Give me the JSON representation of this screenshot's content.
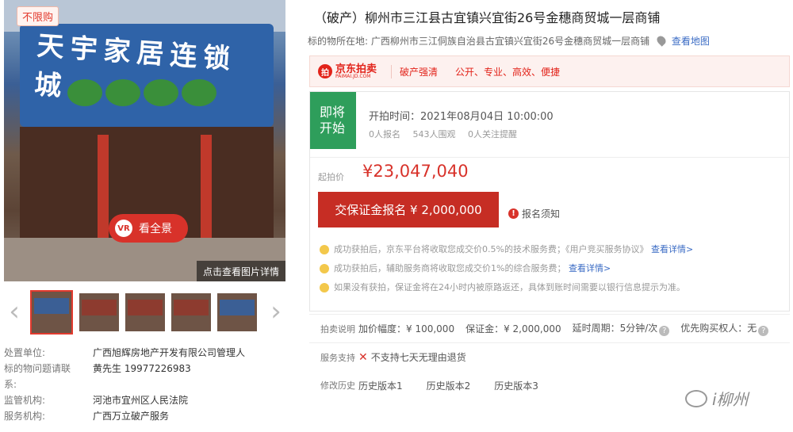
{
  "gallery": {
    "badge": "不限购",
    "sign_text": "天宇家居连锁城",
    "pano_label": "看全景",
    "pano_icon": "VR",
    "detail_label": "点击查看图片详情",
    "prev_icon": "chevron-left-icon",
    "next_icon": "chevron-right-icon"
  },
  "info": [
    {
      "label": "处置单位:",
      "value": "广西旭辉房地产开发有限公司管理人"
    },
    {
      "label": "标的物问题请联",
      "value": "黄先生 19977226983"
    },
    {
      "label": "系:",
      "value": ""
    },
    {
      "label": "监管机构:",
      "value": "河池市宜州区人民法院"
    },
    {
      "label": "服务机构:",
      "value": "广西万立破产服务"
    }
  ],
  "listing": {
    "title": "（破产）柳州市三江县古宜镇兴宜街26号金穗商贸城一层商铺",
    "location_label": "标的物所在地:",
    "location_value": "广西柳州市三江侗族自治县古宜镇兴宜街26号金穗商贸城一层商铺",
    "map_link": "查看地图"
  },
  "brand": {
    "logo_cn": "京东拍卖",
    "logo_en": "PAIMAI.JD.COM",
    "tag": "破产强清",
    "slogan": "公开、专业、高效、便捷"
  },
  "auction": {
    "status_line1": "即将",
    "status_line2": "开始",
    "start_time": "开拍时间：2021年08月04日 10:00:00",
    "signups": "0人报名",
    "watchers": "543人围观",
    "reminders": "0人关注提醒",
    "price_label": "起拍价",
    "price": "¥23,047,040",
    "deposit_button": "交保证金报名 ¥ 2,000,000",
    "notice_link": "报名须知",
    "notice_icon": "!"
  },
  "tips": [
    {
      "text": "成功获拍后，京东平台将收取您成交价0.5%的技术服务费；《用户竞买服务协议》",
      "link": "查看详情>"
    },
    {
      "text": "成功获拍后，辅助服务商将收取您成交价1%的综合服务费；",
      "link": "查看详情>"
    },
    {
      "text": "如果没有获拍，保证金将在24小时内被原路返还，具体到账时间需要以银行信息提示为准。",
      "link": ""
    }
  ],
  "details": {
    "auction_label": "拍卖说明",
    "increment": "加价幅度：¥ 100,000",
    "deposit": "保证金：¥ 2,000,000",
    "delay": "延时周期：5分钟/次",
    "priority": "优先购买权人：无",
    "service_label": "服务支持",
    "service_value": "不支持七天无理由退货",
    "history_label": "修改历史",
    "history_versions": [
      "历史版本1",
      "历史版本2",
      "历史版本3"
    ]
  },
  "watermark": "i柳州",
  "colors": {
    "accent_red": "#d8322a",
    "status_green": "#2e9e5b",
    "link_blue": "#3a6bc4"
  }
}
